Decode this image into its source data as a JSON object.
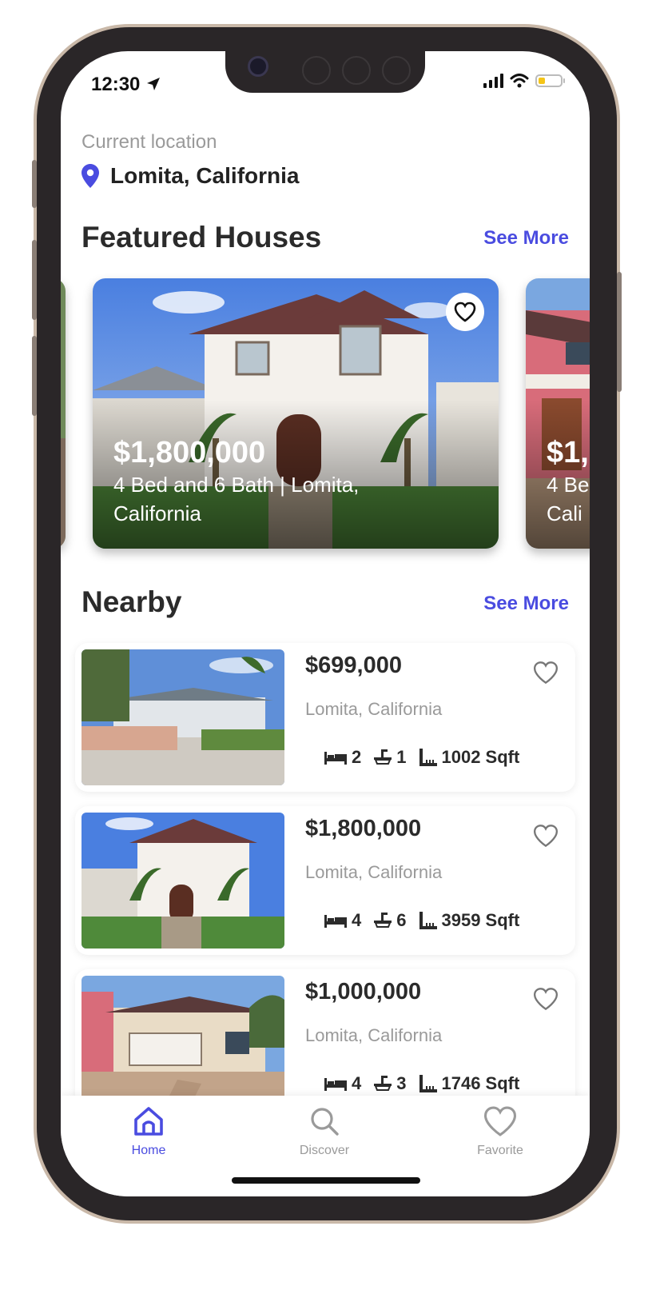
{
  "status_bar": {
    "time": "12:30"
  },
  "location": {
    "label": "Current location",
    "name": "Lomita, California"
  },
  "featured": {
    "title": "Featured Houses",
    "see_more": "See More",
    "cards": [
      {
        "price": "$1,800,000",
        "desc": "4 Bed and 6 Bath | Lomita, California"
      },
      {
        "price": "$1,",
        "desc": "4 Be Cali"
      }
    ]
  },
  "nearby": {
    "title": "Nearby",
    "see_more": "See More",
    "items": [
      {
        "price": "$699,000",
        "location": "Lomita, California",
        "beds": "2",
        "baths": "1",
        "area": "1002 Sqft"
      },
      {
        "price": "$1,800,000",
        "location": "Lomita, California",
        "beds": "4",
        "baths": "6",
        "area": "3959 Sqft"
      },
      {
        "price": "$1,000,000",
        "location": "Lomita, California",
        "beds": "4",
        "baths": "3",
        "area": "1746 Sqft"
      }
    ]
  },
  "nav": [
    {
      "label": "Home",
      "icon": "home-icon",
      "active": true
    },
    {
      "label": "Discover",
      "icon": "search-icon",
      "active": false
    },
    {
      "label": "Favorite",
      "icon": "heart-icon",
      "active": false
    }
  ],
  "colors": {
    "accent": "#4a4ce0",
    "text": "#2b2b2b",
    "muted": "#9a9a9a",
    "frame": "#2a2628"
  }
}
